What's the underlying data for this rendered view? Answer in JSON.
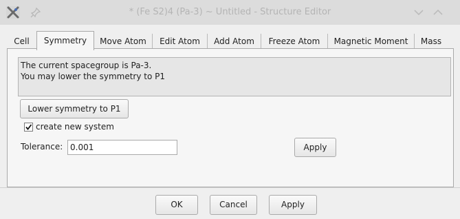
{
  "window": {
    "title": "* (Fe S2)4 (Pa-3) ~ Untitled - Structure Editor"
  },
  "tabs": [
    {
      "label": "Cell"
    },
    {
      "label": "Symmetry"
    },
    {
      "label": "Move Atom"
    },
    {
      "label": "Edit Atom"
    },
    {
      "label": "Add Atom"
    },
    {
      "label": "Freeze Atom"
    },
    {
      "label": "Magnetic Moment"
    },
    {
      "label": "Mass"
    }
  ],
  "active_tab": "Symmetry",
  "symmetry": {
    "info_line1": "The current spacegroup is Pa-3.",
    "info_line2": "You may lower the symmetry to P1",
    "lower_button": "Lower symmetry to P1",
    "create_new_system": {
      "label": "create new system",
      "checked": true
    },
    "tolerance_label": "Tolerance:",
    "tolerance_value": "0.001",
    "apply_button": "Apply"
  },
  "dialog_buttons": {
    "ok": "OK",
    "cancel": "Cancel",
    "apply": "Apply"
  },
  "icons": {
    "app": "app-logo-icon",
    "pin": "pin-icon",
    "minimize": "chevron-down-icon",
    "maximize": "chevron-up-icon"
  }
}
